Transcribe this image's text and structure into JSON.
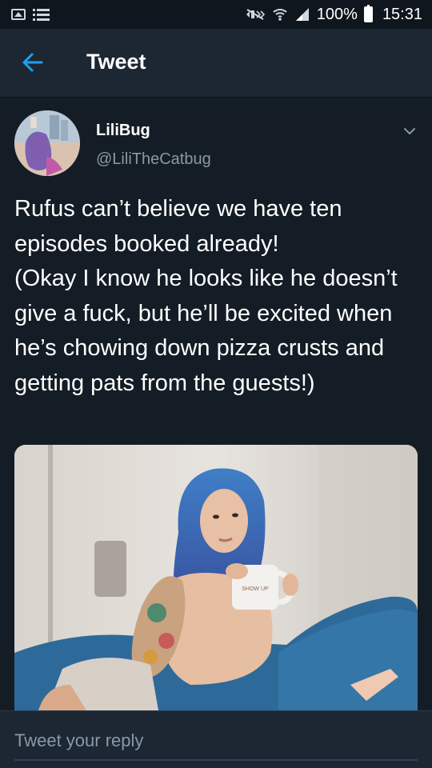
{
  "status_bar": {
    "battery": "100%",
    "time": "15:31"
  },
  "header": {
    "title": "Tweet",
    "back_icon": "arrow-left-icon"
  },
  "tweet": {
    "author_name": "LiliBug",
    "author_handle": "@LiliTheCatbug",
    "text": "Rufus can’t believe we have ten episodes booked already!\n(Okay I know he looks like he doesn’t give a fuck, but he’ll be excited when he’s chowing down pizza crusts and getting pats from the guests!)",
    "mug_text": "SHOW UP"
  },
  "reply": {
    "placeholder": "Tweet your reply"
  },
  "colors": {
    "background": "#141d26",
    "bar": "#1c2733",
    "accent": "#1da1f2",
    "muted": "#8899a6"
  }
}
